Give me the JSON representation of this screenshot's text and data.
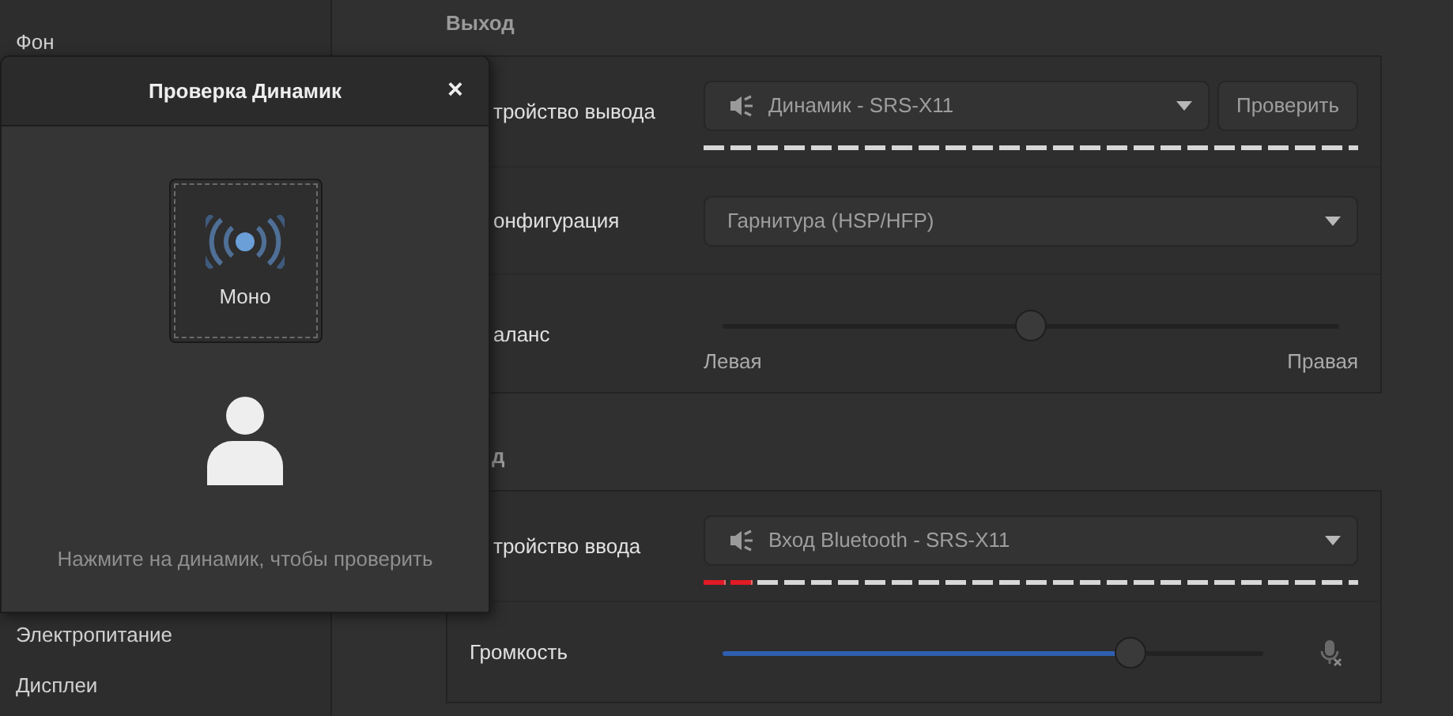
{
  "sidebar": {
    "items": [
      {
        "label": "Фон"
      },
      {
        "label": "Электропитание"
      },
      {
        "label": "Дисплеи"
      }
    ]
  },
  "sections": [
    {
      "heading": "Выход",
      "rows": [
        {
          "kind": "device",
          "label": "тройство вывода",
          "value": "Динамик - SRS-X11",
          "button": "Проверить",
          "meter": {
            "level": 0
          }
        },
        {
          "kind": "combo",
          "label": "онфигурация",
          "value": "Гарнитура (HSP/HFP)"
        },
        {
          "kind": "balance",
          "label": "аланс",
          "level": 0.5,
          "left": "Левая",
          "right": "Правая"
        }
      ]
    },
    {
      "heading": "д",
      "rows": [
        {
          "kind": "device",
          "label": "тройство ввода",
          "value": "Вход Bluetooth - SRS-X11",
          "meter": {
            "level": 0.08
          }
        },
        {
          "kind": "volume",
          "label": "Громкость",
          "level": 0.74,
          "muted": true
        }
      ]
    }
  ],
  "dialog": {
    "title": "Проверка Динамик",
    "close": "×",
    "speaker": {
      "label": "Моно"
    },
    "hint": "Нажмите на динамик, чтобы проверить"
  }
}
